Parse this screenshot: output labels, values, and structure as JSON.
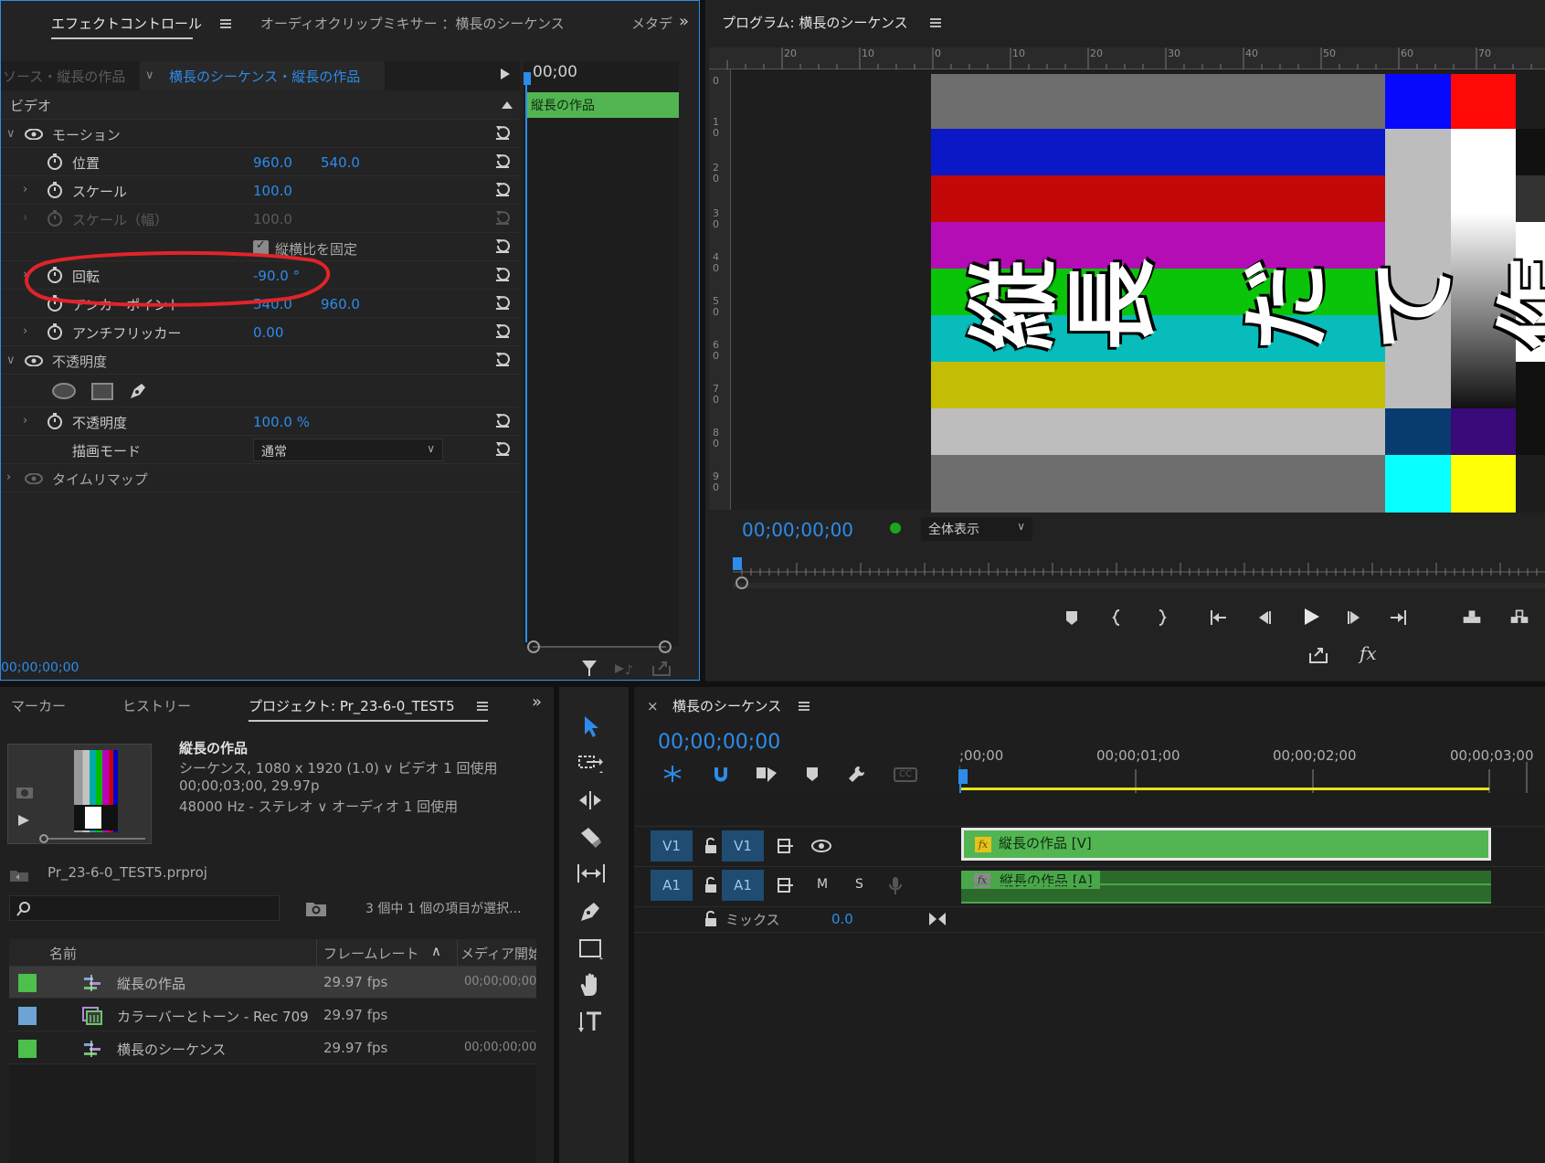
{
  "effect_controls": {
    "tabs": {
      "effect": "エフェクトコントロール",
      "audio_mixer": "オーディオクリップミキサー ：横長のシーケンス",
      "metadata": "メタデ"
    },
    "source_label": "ソース・縦長の作品",
    "sequence_label": "横長のシーケンス・縦長の作品",
    "timeline_tc": "00;00",
    "clip_name": "縦長の作品",
    "video_header": "ビデオ",
    "motion": "モーション",
    "position_label": "位置",
    "position_x": "960.0",
    "position_y": "540.0",
    "scale_label": "スケール",
    "scale_value": "100.0",
    "scale_width_label": "スケール（幅）",
    "scale_width_value": "100.0",
    "uniform_scale": "縦横比を固定",
    "rotation_label": "回転",
    "rotation_value": "-90.0 °",
    "anchor_label": "アンカーポイント",
    "anchor_x": "540.0",
    "anchor_y": "960.0",
    "antiflicker_label": "アンチフリッカー",
    "antiflicker_value": "0.00",
    "opacity_group": "不透明度",
    "opacity_label": "不透明度",
    "opacity_value": "100.0 %",
    "blend_label": "描画モード",
    "blend_value": "通常",
    "time_remap": "タイムリマップ",
    "bottom_tc": "00;00;00;00",
    "annotation_color": "#e0242a"
  },
  "program": {
    "title": "プログラム: 横長のシーケンス",
    "ruler_top": [
      "20",
      "10",
      "0",
      "10",
      "20",
      "30",
      "40",
      "50",
      "60",
      "70"
    ],
    "ruler_left": [
      "0",
      "1\n0",
      "2\n0",
      "3\n0",
      "4\n0",
      "5\n0",
      "6\n0",
      "7\n0",
      "8\n0",
      "9\n0"
    ],
    "video_text": [
      "縦",
      "長",
      "だ",
      "て",
      "作"
    ],
    "timecode": "00;00;00;00",
    "zoom": "全体表示"
  },
  "project_panel": {
    "tabs": {
      "marker": "マーカー",
      "history": "ヒストリー",
      "project": "プロジェクト: Pr_23-6-0_TEST5"
    },
    "info": {
      "name": "縦長の作品",
      "line1": "シーケンス, 1080 x 1920 (1.0) ∨ ビデオ 1 回使用",
      "line2": "00;00;03;00, 29.97p",
      "line3": "48000 Hz - ステレオ ∨ オーディオ 1 回使用"
    },
    "file": "Pr_23-6-0_TEST5.prproj",
    "selection": "3 個中 1 個の項目が選択...",
    "columns": [
      "名前",
      "フレームレート",
      "メディア開始"
    ],
    "items": [
      {
        "name": "縦長の作品",
        "fps": "29.97 fps",
        "start": "00;00;00;00",
        "color": "#4cbf4c"
      },
      {
        "name": "カラーバーとトーン - Rec 709",
        "fps": "29.97 fps",
        "start": "",
        "color": "#6ea3d6"
      },
      {
        "name": "横長のシーケンス",
        "fps": "29.97 fps",
        "start": "00;00;00;00",
        "color": "#4cbf4c"
      }
    ]
  },
  "timeline": {
    "title": "横長のシーケンス",
    "timecode": "00;00;00;00",
    "ticks": [
      ";00;00",
      "00;00;01;00",
      "00;00;02;00",
      "00;00;03;00"
    ],
    "v1": "V1",
    "a1": "A1",
    "m": "M",
    "s": "S",
    "mix": "ミックス",
    "mix_value": "0.0",
    "clip_v": "縦長の作品 [V]",
    "clip_a": "縦長の作品 [A]",
    "fx": "fx",
    "close": "×"
  }
}
